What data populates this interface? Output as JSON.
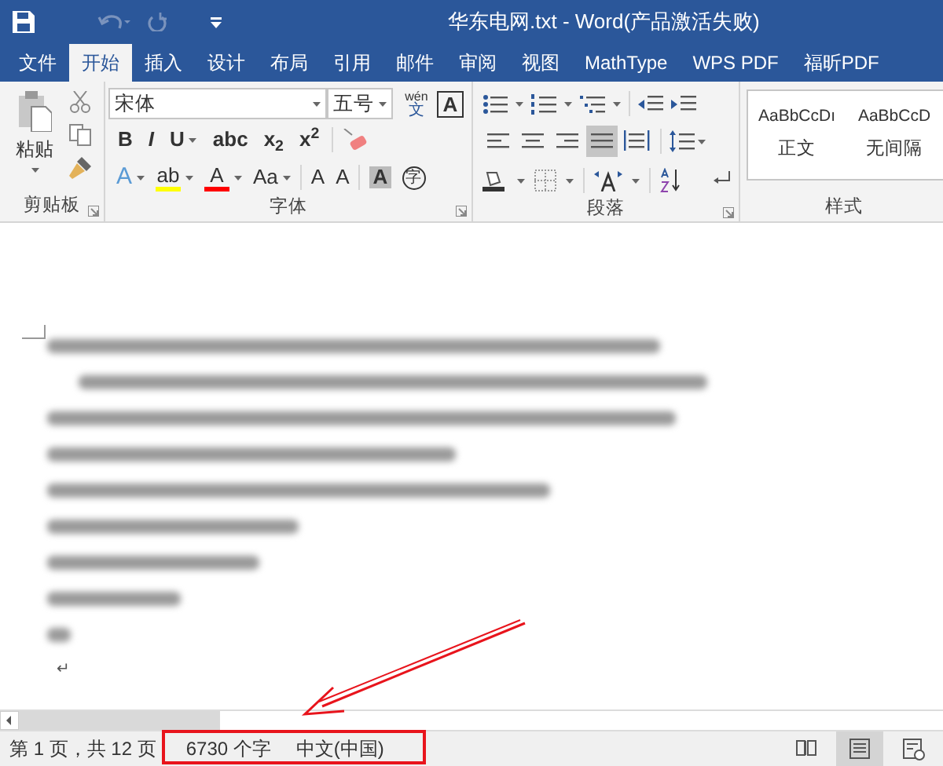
{
  "window": {
    "title": "华东电网.txt - Word(产品激活失败)"
  },
  "tabs": [
    {
      "label": "文件",
      "selected": false
    },
    {
      "label": "开始",
      "selected": true
    },
    {
      "label": "插入",
      "selected": false
    },
    {
      "label": "设计",
      "selected": false
    },
    {
      "label": "布局",
      "selected": false
    },
    {
      "label": "引用",
      "selected": false
    },
    {
      "label": "邮件",
      "selected": false
    },
    {
      "label": "审阅",
      "selected": false
    },
    {
      "label": "视图",
      "selected": false
    },
    {
      "label": "MathType",
      "selected": false
    },
    {
      "label": "WPS PDF",
      "selected": false
    },
    {
      "label": "福昕PDF",
      "selected": false
    }
  ],
  "clipboard": {
    "paste_label": "粘贴",
    "group_label": "剪贴板"
  },
  "font": {
    "font_name": "宋体",
    "font_size": "五号",
    "phonetic_guide": {
      "top": "wén",
      "bottom": "文"
    },
    "char_border": "A",
    "format_buttons": [
      {
        "glyph": "**B**",
        "dropdown": false
      },
      {
        "glyph": "*I*",
        "dropdown": false
      },
      {
        "glyph": "U",
        "dropdown": true
      },
      {
        "glyph": "abc",
        "dropdown": false
      },
      {
        "glyph": "x$_{2}$",
        "dropdown": false
      },
      {
        "glyph": "x$^{2}$",
        "dropdown": false
      }
    ],
    "effect_buttons": [
      {
        "glyph": "A",
        "dropdown": true
      },
      {
        "glyph": "ab",
        "dropdown": true,
        "color": "#ffff00"
      },
      {
        "glyph": "A",
        "dropdown": true,
        "color": "#ff0000"
      },
      {
        "glyph": "Aa",
        "dropdown": true
      },
      {
        "glyph": "A",
        "dropdown": false
      },
      {
        "glyph": "A",
        "dropdown": false
      },
      {
        "glyph": "A",
        "dropdown": false
      },
      {
        "glyph": "字",
        "dropdown": false
      }
    ],
    "group_label": "字体"
  },
  "paragraph": {
    "alignment": [
      {
        "selected": false
      },
      {
        "selected": false
      },
      {
        "selected": false
      },
      {
        "selected": true
      },
      {
        "selected": false
      }
    ],
    "group_label": "段落"
  },
  "styles": {
    "items": [
      {
        "preview": "AaBbCcDı",
        "name": "正文"
      },
      {
        "preview": "AaBbCcD",
        "name": "无间隔"
      }
    ],
    "group_label": "样式"
  },
  "document": {
    "paragraph_mark": "↵"
  },
  "status_bar": {
    "page": "第 1 页，共 12 页",
    "word_count": "6730 个字",
    "language": "中文(中国)",
    "views": [
      {
        "kind": "read",
        "selected": false
      },
      {
        "kind": "print",
        "selected": true
      },
      {
        "kind": "web",
        "selected": false
      }
    ]
  }
}
